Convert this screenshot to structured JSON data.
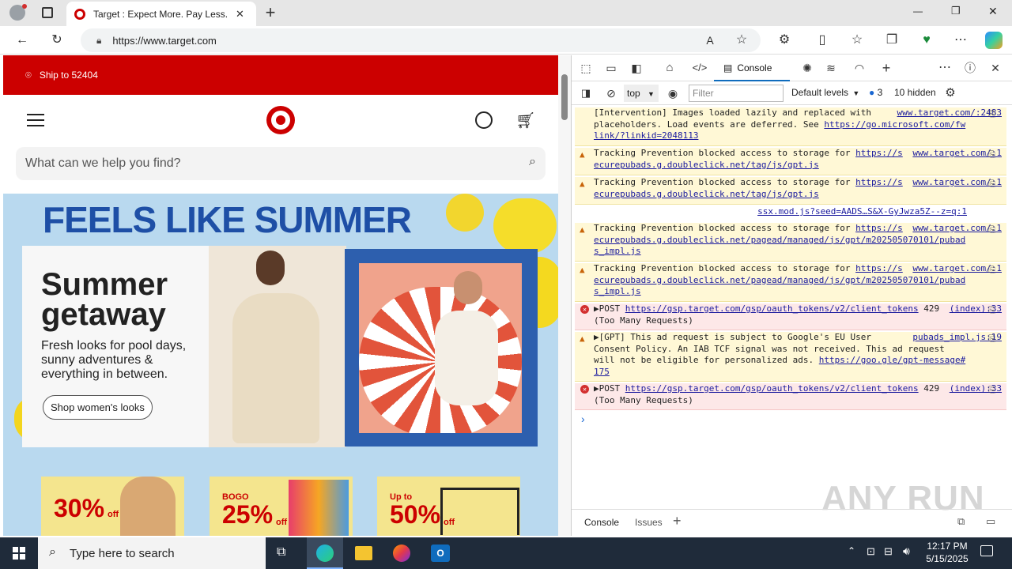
{
  "browser": {
    "tab_title": "Target : Expect More. Pay Less.",
    "url_host": "https://www.target.com",
    "new_tab_symbol": "+",
    "window_controls": {
      "minimize": "—",
      "maximize": "❐",
      "close": "✕"
    },
    "read_aloud_label": "A"
  },
  "page": {
    "ship_to": "Ship to 52404",
    "search_placeholder": "What can we help you find?",
    "hero_headline": "FEELS LIKE SUMMER",
    "hero_title_line1": "Summer",
    "hero_title_line2": "getaway",
    "hero_text": "Fresh looks for pool days, sunny adventures & everything in between.",
    "shop_button": "Shop women's looks",
    "promos": [
      {
        "small": "",
        "big": "30%",
        "suffix": "off"
      },
      {
        "small": "BOGO",
        "big": "25%",
        "suffix": "off"
      },
      {
        "small": "Up to",
        "big": "50%",
        "suffix": "off"
      }
    ],
    "colors": {
      "brand_red": "#cc0000",
      "hero_blue": "#1e4fa6",
      "hero_bg": "#b9d9ef"
    }
  },
  "devtools": {
    "console_tab": "Console",
    "context": "top",
    "filter_placeholder": "Filter",
    "levels": "Default levels",
    "issues_count": "3",
    "hidden": "10 hidden",
    "messages": [
      {
        "type": "info",
        "text": "[Intervention] Images loaded lazily and replaced with placeholders. Load events are deferred. See ",
        "link": "https://go.microsoft.com/fwlink/?linkid=2048113",
        "source": "www.target.com/:2483"
      },
      {
        "type": "warn",
        "text": "Tracking Prevention blocked access to storage for ",
        "link": "https://securepubads.g.doubleclick.net/tag/js/gpt.js",
        "source": "www.target.com/:1"
      },
      {
        "type": "warn",
        "text": "Tracking Prevention blocked access to storage for ",
        "link": "https://securepubads.g.doubleclick.net/tag/js/gpt.js",
        "source": "www.target.com/:1"
      },
      {
        "type": "plain",
        "text": "",
        "link": "",
        "source": "ssx.mod.js?seed=AADS…S&X-GyJwza5Z--z=q:1"
      },
      {
        "type": "warn",
        "text": "Tracking Prevention blocked access to storage for ",
        "link": "https://securepubads.g.doubleclick.net/pagead/managed/js/gpt/m202505070101/pubads_impl.js",
        "source": "www.target.com/:1"
      },
      {
        "type": "warn",
        "text": "Tracking Prevention blocked access to storage for ",
        "link": "https://securepubads.g.doubleclick.net/pagead/managed/js/gpt/m202505070101/pubads_impl.js",
        "source": "www.target.com/:1"
      },
      {
        "type": "error",
        "text": "▶POST ",
        "link": "https://gsp.target.com/gsp/oauth_tokens/v2/client_tokens",
        "tail": " 429 (Too Many Requests)",
        "source": "(index):33"
      },
      {
        "type": "warn",
        "text": "▶[GPT] This ad request is subject to Google's EU User Consent Policy. An IAB TCF signal was not received. This ad request will not be eligible for personalized ads. ",
        "link": "https://goo.gle/gpt-message#175",
        "source": "pubads_impl.js:19"
      },
      {
        "type": "error",
        "text": "▶POST ",
        "link": "https://gsp.target.com/gsp/oauth_tokens/v2/client_tokens",
        "tail": " 429 (Too Many Requests)",
        "source": "(index):33"
      }
    ],
    "prompt": "›",
    "bottom_tabs": [
      "Console",
      "Issues"
    ]
  },
  "taskbar": {
    "search_placeholder": "Type here to search",
    "time": "12:17 PM",
    "date": "5/15/2025"
  },
  "watermark": "ANY RUN"
}
